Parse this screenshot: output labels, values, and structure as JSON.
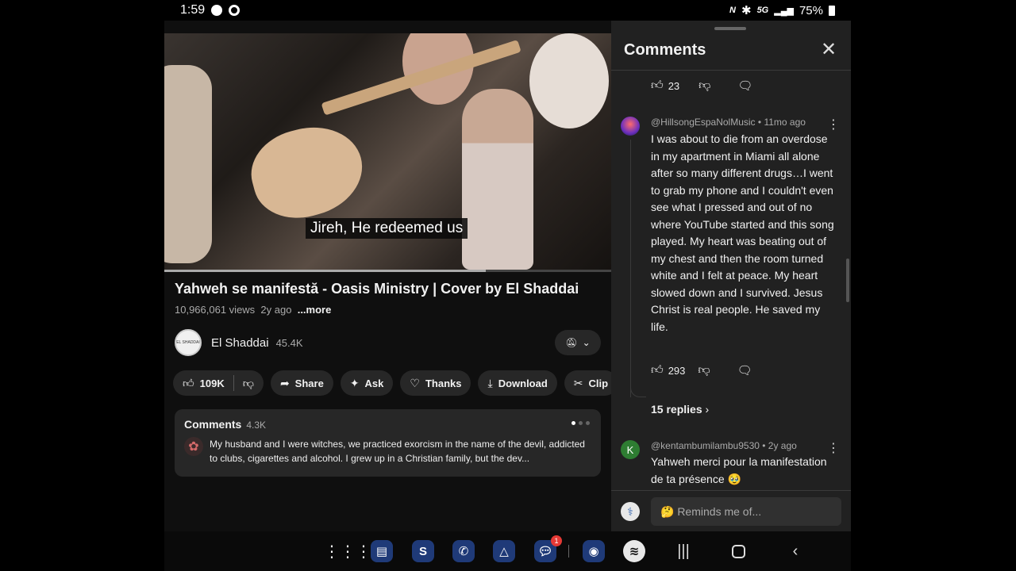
{
  "status_bar": {
    "time": "1:59",
    "network": "5G",
    "battery": "75%"
  },
  "video": {
    "caption": "Jireh, He redeemed us",
    "progress": 0.72,
    "title": "Yahweh se manifestă - Oasis Ministry | Cover by El Shaddai",
    "views": "10,966,061 views",
    "age": "2y ago",
    "more_label": "...more"
  },
  "channel": {
    "name": "El Shaddai",
    "subscribers": "45.4K",
    "avatar_text": "EL SHADDAI"
  },
  "actions": {
    "likes": "109K",
    "share": "Share",
    "ask": "Ask",
    "thanks": "Thanks",
    "download": "Download",
    "clip": "Clip"
  },
  "comments_card": {
    "title": "Comments",
    "count": "4.3K",
    "preview": "My husband and I were witches, we practiced exorcism in the name of the devil, addicted to clubs, cigarettes and alcohol. I grew up in a Christian family, but the dev..."
  },
  "comments_panel": {
    "title": "Comments",
    "top_row_likes": "23",
    "comment1": {
      "author": "@HillsongEspaNolMusic",
      "age": "11mo ago",
      "text": "I was about to die from an overdose in my apartment in Miami all alone after so many different drugs…I went to grab my phone and I couldn't even see what I pressed and out of no where YouTube started and this song played. My heart was beating out of my chest and then the room turned white and I felt at peace. My heart slowed down and I survived. Jesus Christ is real people. He saved my life.",
      "likes": "293",
      "replies": "15 replies"
    },
    "comment2": {
      "avatar_letter": "K",
      "author": "@kentambumilambu9530",
      "age": "2y ago",
      "text": "Yahweh merci pour la manifestation de ta présence 🥹"
    },
    "reply_placeholder": "🤔 Reminds me of..."
  },
  "taskbar": {
    "messages_badge": "1"
  },
  "colors": {
    "panel_bg": "#212121",
    "page_bg": "#0f0f0f",
    "pill_bg": "#272727"
  }
}
